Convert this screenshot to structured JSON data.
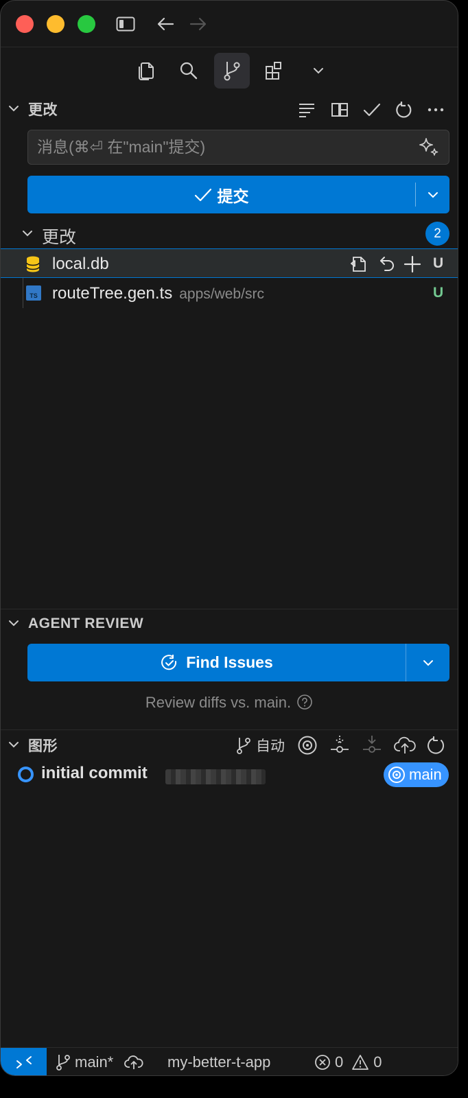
{
  "scm": {
    "changes_title": "更改",
    "message_placeholder": "消息(⌘⏎ 在\"main\"提交)",
    "commit_label": "提交",
    "changes_group_label": "更改",
    "changes_count": "2",
    "files": [
      {
        "name": "local.db",
        "path": "",
        "status": "U"
      },
      {
        "name": "routeTree.gen.ts",
        "path": "apps/web/src",
        "status": "U"
      }
    ]
  },
  "agent_review": {
    "title": "AGENT REVIEW",
    "button_label": "Find Issues",
    "note": "Review diffs vs. main."
  },
  "graph": {
    "title": "图形",
    "auto_label": "自动",
    "commits": [
      {
        "message": "initial commit",
        "branch": "main"
      }
    ]
  },
  "statusbar": {
    "branch": "main*",
    "project": "my-better-t-app",
    "errors": "0",
    "warnings": "0"
  },
  "colors": {
    "accent": "#0078d4",
    "graph_blue": "#3794ff",
    "untracked_green": "#73c991",
    "db_icon_yellow": "#f5c518"
  }
}
